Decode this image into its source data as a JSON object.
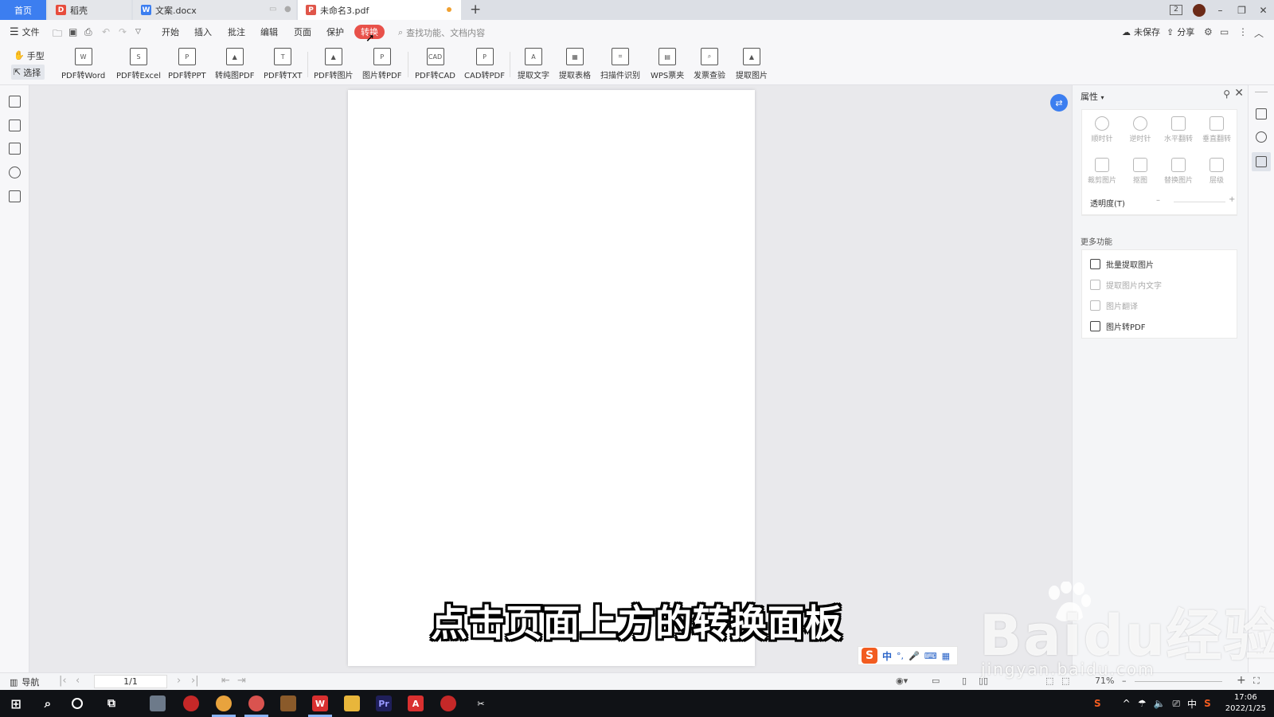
{
  "tabs": {
    "home": "首页",
    "daoke": "稻壳",
    "doc": "文案.docx",
    "pdf": "未命名3.pdf",
    "new_tab": "+"
  },
  "window_controls": {
    "window_count": "2",
    "minimize": "–",
    "restore": "❐",
    "close": "✕"
  },
  "menu": {
    "file": "文件",
    "items": [
      "开始",
      "插入",
      "批注",
      "编辑",
      "页面",
      "保护",
      "转换"
    ],
    "active": "转换",
    "search_placeholder": "查找功能、文档内容",
    "unsaved": "未保存",
    "share": "分享"
  },
  "toolbar": {
    "hand": "手型",
    "select": "选择",
    "buttons": [
      "PDF转Word",
      "PDF转Excel",
      "PDF转PPT",
      "转纯图PDF",
      "PDF转TXT",
      "PDF转图片",
      "图片转PDF",
      "PDF转CAD",
      "CAD转PDF",
      "提取文字",
      "提取表格",
      "扫描件识别",
      "WPS票夹",
      "发票查验",
      "提取图片"
    ]
  },
  "properties_panel": {
    "title": "属性",
    "transform_tools": [
      "顺时针",
      "逆时针",
      "水平翻转",
      "垂直翻转"
    ],
    "image_tools": [
      "裁剪图片",
      "抠图",
      "替换图片",
      "层级"
    ],
    "opacity_label": "透明度(T)",
    "more_title": "更多功能",
    "more_items": [
      {
        "label": "批量提取图片",
        "enabled": true
      },
      {
        "label": "提取图片内文字",
        "enabled": false
      },
      {
        "label": "图片翻译",
        "enabled": false
      },
      {
        "label": "图片转PDF",
        "enabled": true
      }
    ]
  },
  "statusbar": {
    "nav": "导航",
    "page": "1/1",
    "zoom": "71%"
  },
  "subtitle": "点击页面上方的转换面板",
  "ime": {
    "logo": "S",
    "lang": "中"
  },
  "watermark": {
    "brand": "Baidu经验",
    "url": "jingyan.baidu.com"
  },
  "taskbar": {
    "tray_lang": "中",
    "time": "17:06",
    "date": "2022/1/25"
  },
  "colors": {
    "accent_blue": "#3c7ef0",
    "convert_red": "#e8514a",
    "taskbar": "#101216"
  }
}
